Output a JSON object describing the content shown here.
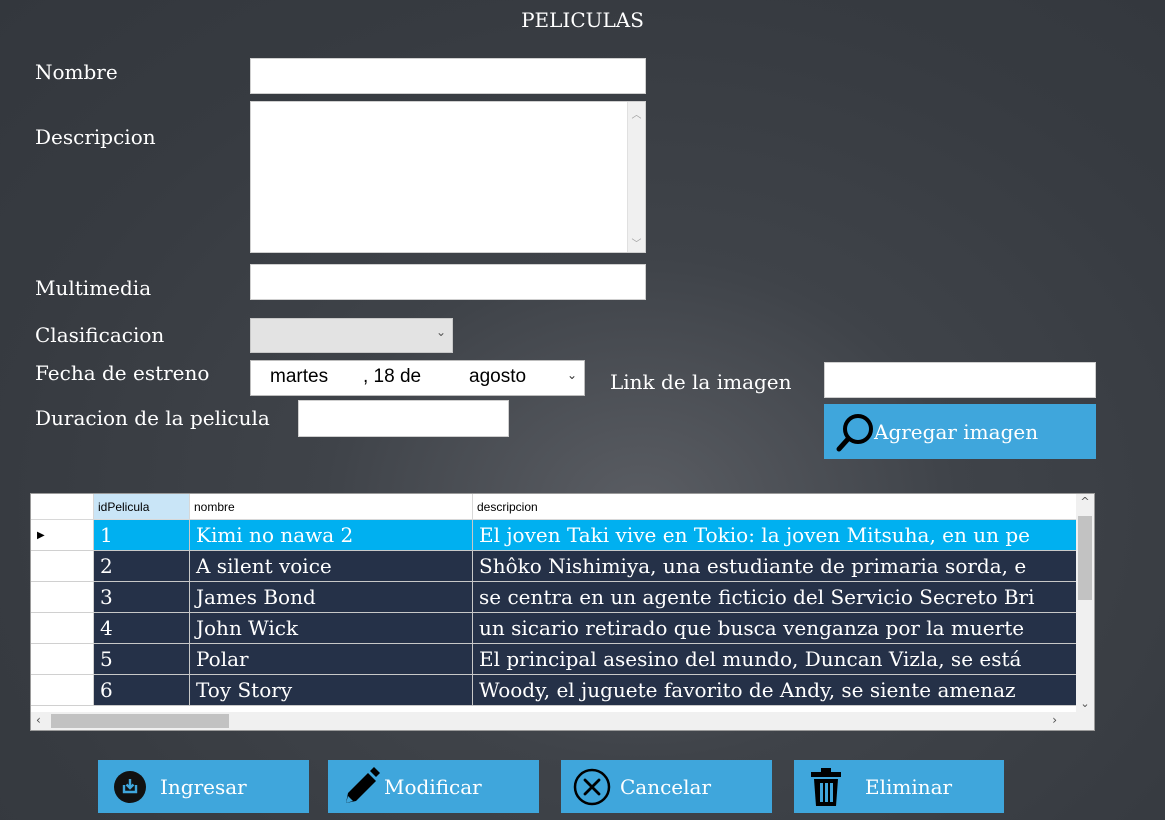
{
  "title": "PELICULAS",
  "form": {
    "nombre_label": "Nombre",
    "nombre_value": "",
    "descripcion_label": "Descripcion",
    "descripcion_value": "",
    "multimedia_label": "Multimedia",
    "multimedia_value": "",
    "clasificacion_label": "Clasificacion",
    "clasificacion_value": "",
    "fecha_label": "Fecha de estreno",
    "fecha": {
      "weekday": "martes",
      "day_part": ", 18 de",
      "month": "agosto"
    },
    "duracion_label": "Duracion de la pelicula",
    "duracion_value": "",
    "link_label": "Link de la imagen",
    "link_value": ""
  },
  "agregar_imagen_label": "Agregar imagen",
  "grid": {
    "columns": [
      "idPelicula",
      "nombre",
      "descripcion"
    ],
    "rows": [
      {
        "id": "1",
        "nombre": "Kimi no nawa 2",
        "descripcion": "El joven Taki vive en Tokio: la joven Mitsuha, en un pe",
        "selected": true
      },
      {
        "id": "2",
        "nombre": "A silent voice",
        "descripcion": "Shôko Nishimiya, una estudiante de primaria sorda, e",
        "selected": false
      },
      {
        "id": "3",
        "nombre": "James Bond",
        "descripcion": "se centra en un agente ficticio del Servicio Secreto Bri",
        "selected": false
      },
      {
        "id": "4",
        "nombre": "John Wick",
        "descripcion": "un sicario retirado que busca venganza por la muerte",
        "selected": false
      },
      {
        "id": "5",
        "nombre": "Polar",
        "descripcion": "El principal asesino del mundo, Duncan Vizla, se está",
        "selected": false
      },
      {
        "id": "6",
        "nombre": "Toy Story",
        "descripcion": "Woody, el juguete favorito de Andy, se siente amenaz",
        "selected": false
      }
    ]
  },
  "buttons": {
    "ingresar": "Ingresar",
    "modificar": "Modificar",
    "cancelar": "Cancelar",
    "eliminar": "Eliminar"
  },
  "colors": {
    "button_blue": "#3fa6dc",
    "row_selected": "#00b0f0",
    "row_normal": "#253148"
  }
}
